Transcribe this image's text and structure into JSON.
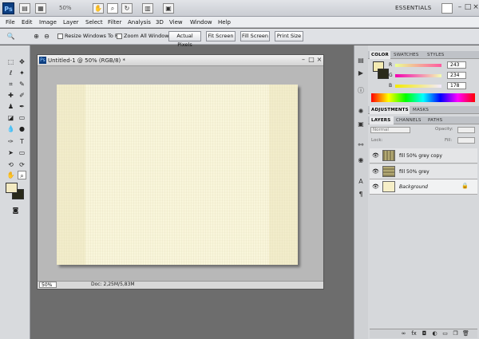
{
  "app": {
    "logo": "Ps",
    "zoom": "50%",
    "workspace": "ESSENTIALS"
  },
  "menu": [
    "File",
    "Edit",
    "Image",
    "Layer",
    "Select",
    "Filter",
    "Analysis",
    "3D",
    "View",
    "Window",
    "Help"
  ],
  "options": {
    "resize_label": "Resize Windows To Fit",
    "zoom_all_label": "Zoom All Windows",
    "actual_pixels": "Actual Pixels",
    "fit_screen": "Fit Screen",
    "fill_screen": "Fill Screen",
    "print_size": "Print Size"
  },
  "document": {
    "title": "Untitled-1 @ 50% (RGB/8) *",
    "zoom": "50%",
    "info": "Doc: 2,25M/5,83M"
  },
  "color_panel": {
    "tabs": [
      "COLOR",
      "SWATCHES",
      "STYLES"
    ],
    "r_label": "R",
    "g_label": "G",
    "b_label": "B",
    "r": "243",
    "g": "234",
    "b": "178",
    "fg_color": "#f3eab2"
  },
  "adjust_tabs": [
    "ADJUSTMENTS",
    "MASKS"
  ],
  "layers_panel": {
    "tabs": [
      "LAYERS",
      "CHANNELS",
      "PATHS"
    ],
    "blend": "Normal",
    "opacity_label": "Opacity:",
    "lock_label": "Lock:",
    "fill_label": "Fill:",
    "layers": [
      {
        "name": "fill 50% grey copy"
      },
      {
        "name": "fill 50% grey"
      },
      {
        "name": "Background"
      }
    ]
  }
}
